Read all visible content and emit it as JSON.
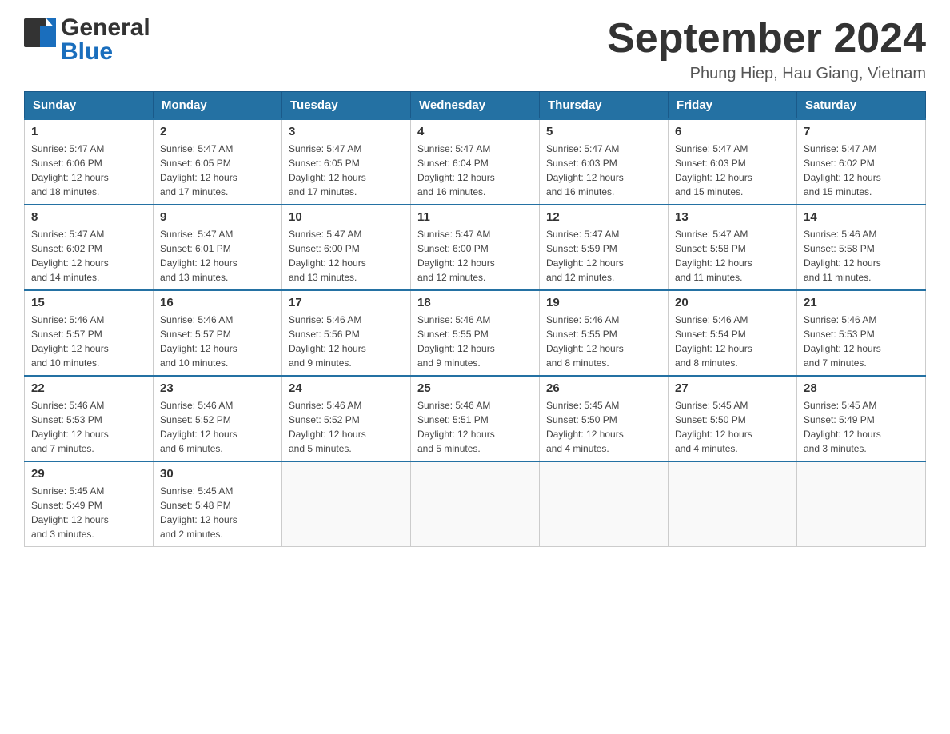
{
  "header": {
    "logo_general": "General",
    "logo_blue": "Blue",
    "title": "September 2024",
    "location": "Phung Hiep, Hau Giang, Vietnam"
  },
  "days_of_week": [
    "Sunday",
    "Monday",
    "Tuesday",
    "Wednesday",
    "Thursday",
    "Friday",
    "Saturday"
  ],
  "weeks": [
    [
      {
        "day": "1",
        "sunrise": "5:47 AM",
        "sunset": "6:06 PM",
        "daylight": "12 hours and 18 minutes."
      },
      {
        "day": "2",
        "sunrise": "5:47 AM",
        "sunset": "6:05 PM",
        "daylight": "12 hours and 17 minutes."
      },
      {
        "day": "3",
        "sunrise": "5:47 AM",
        "sunset": "6:05 PM",
        "daylight": "12 hours and 17 minutes."
      },
      {
        "day": "4",
        "sunrise": "5:47 AM",
        "sunset": "6:04 PM",
        "daylight": "12 hours and 16 minutes."
      },
      {
        "day": "5",
        "sunrise": "5:47 AM",
        "sunset": "6:03 PM",
        "daylight": "12 hours and 16 minutes."
      },
      {
        "day": "6",
        "sunrise": "5:47 AM",
        "sunset": "6:03 PM",
        "daylight": "12 hours and 15 minutes."
      },
      {
        "day": "7",
        "sunrise": "5:47 AM",
        "sunset": "6:02 PM",
        "daylight": "12 hours and 15 minutes."
      }
    ],
    [
      {
        "day": "8",
        "sunrise": "5:47 AM",
        "sunset": "6:02 PM",
        "daylight": "12 hours and 14 minutes."
      },
      {
        "day": "9",
        "sunrise": "5:47 AM",
        "sunset": "6:01 PM",
        "daylight": "12 hours and 13 minutes."
      },
      {
        "day": "10",
        "sunrise": "5:47 AM",
        "sunset": "6:00 PM",
        "daylight": "12 hours and 13 minutes."
      },
      {
        "day": "11",
        "sunrise": "5:47 AM",
        "sunset": "6:00 PM",
        "daylight": "12 hours and 12 minutes."
      },
      {
        "day": "12",
        "sunrise": "5:47 AM",
        "sunset": "5:59 PM",
        "daylight": "12 hours and 12 minutes."
      },
      {
        "day": "13",
        "sunrise": "5:47 AM",
        "sunset": "5:58 PM",
        "daylight": "12 hours and 11 minutes."
      },
      {
        "day": "14",
        "sunrise": "5:46 AM",
        "sunset": "5:58 PM",
        "daylight": "12 hours and 11 minutes."
      }
    ],
    [
      {
        "day": "15",
        "sunrise": "5:46 AM",
        "sunset": "5:57 PM",
        "daylight": "12 hours and 10 minutes."
      },
      {
        "day": "16",
        "sunrise": "5:46 AM",
        "sunset": "5:57 PM",
        "daylight": "12 hours and 10 minutes."
      },
      {
        "day": "17",
        "sunrise": "5:46 AM",
        "sunset": "5:56 PM",
        "daylight": "12 hours and 9 minutes."
      },
      {
        "day": "18",
        "sunrise": "5:46 AM",
        "sunset": "5:55 PM",
        "daylight": "12 hours and 9 minutes."
      },
      {
        "day": "19",
        "sunrise": "5:46 AM",
        "sunset": "5:55 PM",
        "daylight": "12 hours and 8 minutes."
      },
      {
        "day": "20",
        "sunrise": "5:46 AM",
        "sunset": "5:54 PM",
        "daylight": "12 hours and 8 minutes."
      },
      {
        "day": "21",
        "sunrise": "5:46 AM",
        "sunset": "5:53 PM",
        "daylight": "12 hours and 7 minutes."
      }
    ],
    [
      {
        "day": "22",
        "sunrise": "5:46 AM",
        "sunset": "5:53 PM",
        "daylight": "12 hours and 7 minutes."
      },
      {
        "day": "23",
        "sunrise": "5:46 AM",
        "sunset": "5:52 PM",
        "daylight": "12 hours and 6 minutes."
      },
      {
        "day": "24",
        "sunrise": "5:46 AM",
        "sunset": "5:52 PM",
        "daylight": "12 hours and 5 minutes."
      },
      {
        "day": "25",
        "sunrise": "5:46 AM",
        "sunset": "5:51 PM",
        "daylight": "12 hours and 5 minutes."
      },
      {
        "day": "26",
        "sunrise": "5:45 AM",
        "sunset": "5:50 PM",
        "daylight": "12 hours and 4 minutes."
      },
      {
        "day": "27",
        "sunrise": "5:45 AM",
        "sunset": "5:50 PM",
        "daylight": "12 hours and 4 minutes."
      },
      {
        "day": "28",
        "sunrise": "5:45 AM",
        "sunset": "5:49 PM",
        "daylight": "12 hours and 3 minutes."
      }
    ],
    [
      {
        "day": "29",
        "sunrise": "5:45 AM",
        "sunset": "5:49 PM",
        "daylight": "12 hours and 3 minutes."
      },
      {
        "day": "30",
        "sunrise": "5:45 AM",
        "sunset": "5:48 PM",
        "daylight": "12 hours and 2 minutes."
      },
      null,
      null,
      null,
      null,
      null
    ]
  ],
  "labels": {
    "sunrise": "Sunrise:",
    "sunset": "Sunset:",
    "daylight": "Daylight:"
  }
}
